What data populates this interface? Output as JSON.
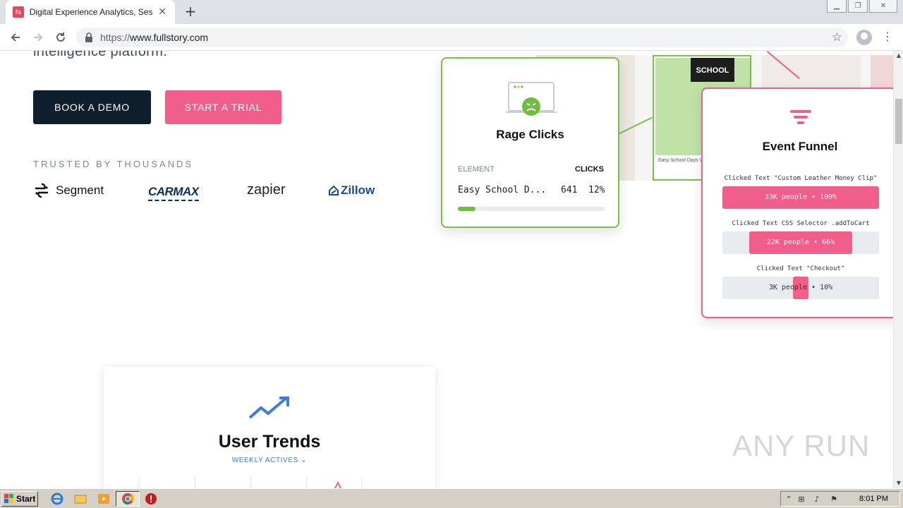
{
  "browser": {
    "tab_title": "Digital Experience Analytics, Session Replay",
    "favicon_text": "fs",
    "url_scheme": "https://",
    "url_host": "www.fullstory.com"
  },
  "hero": {
    "cut_text": "intelligence platform.",
    "book_demo": "BOOK A DEMO",
    "start_trial": "START A TRIAL",
    "trusted": "TRUSTED BY THOUSANDS"
  },
  "logos": {
    "segment": "Segment",
    "carmax": "CARMAX",
    "zapier": "zapier",
    "zillow": "Zillow"
  },
  "product_shot": {
    "chalk_text": "SCHOOL",
    "caption": "Easy School Days Wi..."
  },
  "rage_clicks": {
    "title": "Rage Clicks",
    "col_element": "ELEMENT",
    "col_clicks": "CLICKS",
    "row_element": "Easy School D...",
    "row_clicks": "641",
    "row_percent": "12%",
    "progress": 0.12
  },
  "event_funnel": {
    "title": "Event Funnel",
    "steps": [
      {
        "label": "Clicked Text \"Custom Leather Money Clip\"",
        "value": "33K people • 100%",
        "fraction": 1.0
      },
      {
        "label": "Clicked Text CSS Selector .addToCart",
        "value": "22K people • 66%",
        "fraction": 0.66
      },
      {
        "label": "Clicked Text \"Checkout\"",
        "value": "3K people • 10%",
        "fraction": 0.1
      }
    ]
  },
  "user_trends": {
    "title": "User Trends",
    "subtitle": "WEEKLY ACTIVES"
  },
  "watermark": "ANY RUN",
  "taskbar": {
    "start": "Start",
    "clock": "8:01 PM"
  }
}
